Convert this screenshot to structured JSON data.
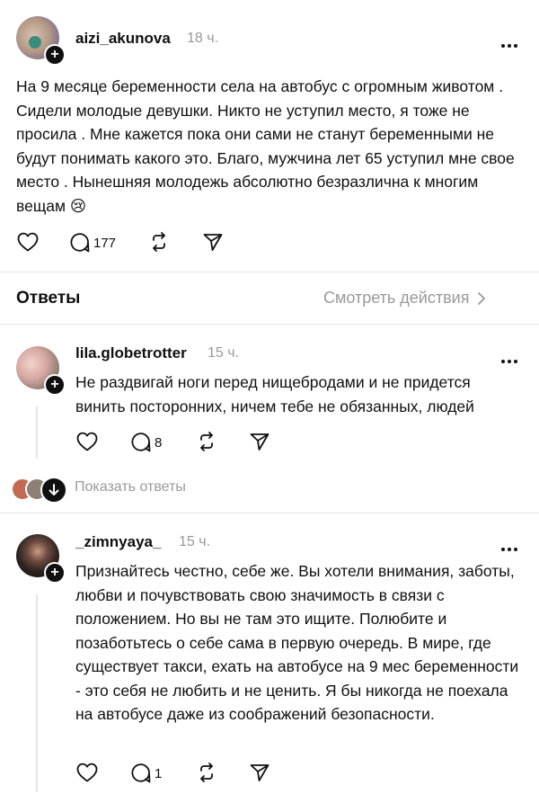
{
  "post": {
    "username": "aizi_akunova",
    "time": "18 ч.",
    "text": "На 9 месяце беременности села на автобус с огромным животом . Сидели молодые девушки. Никто не уступил место, я тоже не просила . Мне кажется пока они сами не станут беременными не будут понимать какого это. Благо, мужчина лет 65 уступил мне свое место . Нынешняя молодежь абсолютно безразлична к многим вещам 😢",
    "reply_count": "177",
    "avatar_color": "#b59a86"
  },
  "replies_header": {
    "title": "Ответы",
    "view_actions": "Смотреть действия"
  },
  "replies": [
    {
      "username": "lila.globetrotter",
      "time": "15 ч.",
      "text": "Не раздвигай ноги перед нищебродами и не придется винить посторонних, ничем тебе не обязанных, людей",
      "reply_count": "8",
      "avatar_color": "#c79a94",
      "show_replies": "Показать ответы"
    },
    {
      "username": "_zimnyaya_",
      "time": "15 ч.",
      "text": "Признайтесь честно, себе же. Вы хотели внимания, заботы, любви и почувствовать свою значимость в связи с положением. Но вы не там это ищите. Полюбите и позаботьтесь о себе сама в первую очередь. В мире, где существует такси, ехать на автобусе на 9 мес беременности - это себя не любить и не ценить. Я бы никогда не поехала на автобусе даже из соображений безопасности.",
      "reply_count": "1",
      "avatar_color": "#2c2320"
    }
  ],
  "colors": {
    "text": "#101010",
    "muted": "#999999",
    "divider": "#e5e5e5"
  }
}
